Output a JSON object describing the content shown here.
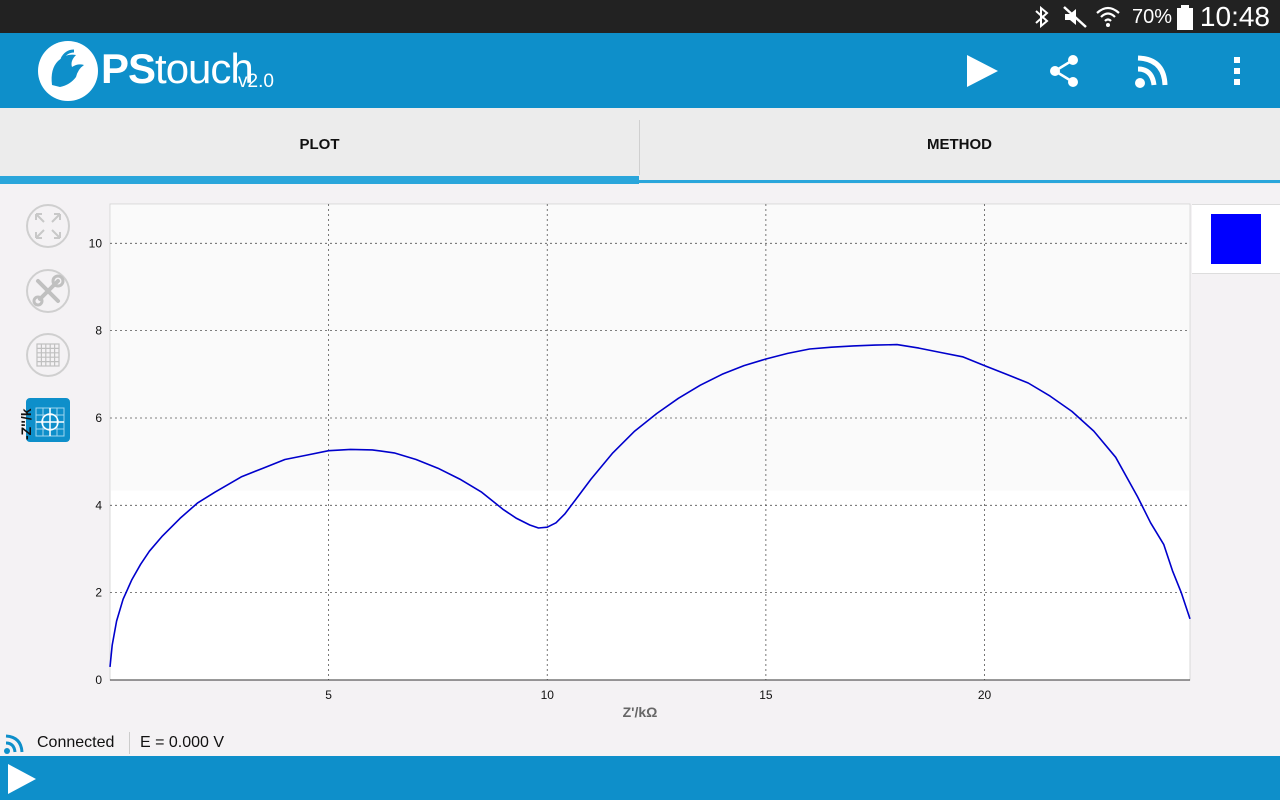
{
  "status_bar": {
    "battery_percent": "70%",
    "time": "10:48",
    "icons": [
      "bluetooth-icon",
      "mute-icon",
      "wifi-icon",
      "battery-icon"
    ]
  },
  "app_bar": {
    "brand_bold": "PS",
    "brand_light": "touch",
    "version": "v2.0",
    "actions": [
      "play-icon",
      "share-icon",
      "connect-icon",
      "overflow-menu-icon"
    ]
  },
  "tabs": [
    {
      "label": "PLOT",
      "active": true
    },
    {
      "label": "METHOD",
      "active": false
    }
  ],
  "tools": [
    "zoom-fit-icon",
    "settings-wrench-icon",
    "grid-icon",
    "crosshair-icon"
  ],
  "legend": {
    "series_color": "#0000ff"
  },
  "footer": {
    "connection": "Connected",
    "potential": "E = 0.000 V"
  },
  "colors": {
    "accent": "#0e8fca",
    "tab_indicator": "#2aa6db",
    "series": "#0000cc"
  },
  "chart_data": {
    "type": "line",
    "xlabel": "Z'/kΩ",
    "ylabel": "-Z''/k",
    "xlim": [
      0,
      24.7
    ],
    "ylim": [
      0,
      10.9
    ],
    "xticks": [
      5,
      10,
      15,
      20
    ],
    "yticks": [
      0,
      2,
      4,
      6,
      8,
      10
    ],
    "grid": true,
    "series": [
      {
        "x": [
          0.0,
          0.05,
          0.15,
          0.3,
          0.5,
          0.7,
          0.9,
          1.2,
          1.6,
          2.0,
          2.4,
          3.0,
          3.5,
          4.0,
          4.5,
          5.0,
          5.5,
          6.0,
          6.5,
          7.0,
          7.5,
          8.0,
          8.5,
          9.0,
          9.3,
          9.6,
          9.8,
          10.0,
          10.2,
          10.4,
          10.7,
          11.0,
          11.5,
          12.0,
          12.5,
          13.0,
          13.5,
          14.0,
          14.5,
          15.0,
          15.5,
          16.0,
          16.5,
          17.0,
          17.5,
          18.0,
          18.5,
          19.0,
          19.5,
          20.0,
          20.5,
          21.0,
          21.5,
          22.0,
          22.5,
          23.0,
          23.5,
          23.8,
          24.1,
          24.3,
          24.5,
          24.7
        ],
        "y": [
          0.3,
          0.8,
          1.35,
          1.85,
          2.3,
          2.65,
          2.95,
          3.3,
          3.7,
          4.05,
          4.3,
          4.65,
          4.85,
          5.05,
          5.15,
          5.25,
          5.28,
          5.27,
          5.2,
          5.05,
          4.85,
          4.6,
          4.3,
          3.9,
          3.7,
          3.55,
          3.48,
          3.5,
          3.6,
          3.8,
          4.2,
          4.6,
          5.2,
          5.7,
          6.1,
          6.45,
          6.75,
          7.0,
          7.2,
          7.35,
          7.48,
          7.58,
          7.62,
          7.65,
          7.67,
          7.68,
          7.6,
          7.5,
          7.4,
          7.2,
          7.0,
          6.8,
          6.5,
          6.15,
          5.7,
          5.1,
          4.2,
          3.6,
          3.1,
          2.5,
          2.0,
          1.4
        ]
      }
    ]
  }
}
